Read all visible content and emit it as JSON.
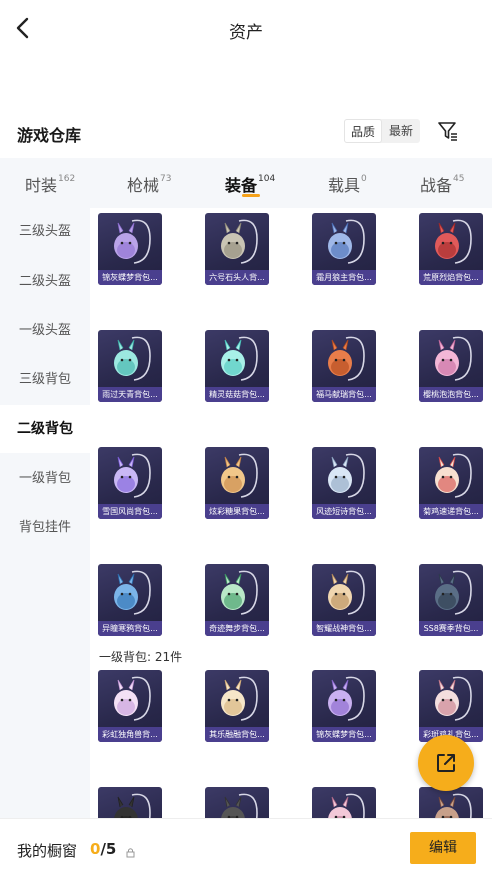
{
  "header": {
    "title": "资产"
  },
  "warehouse": {
    "title": "游戏仓库",
    "sort": [
      "品质",
      "最新"
    ]
  },
  "tabs": [
    {
      "label": "时装",
      "count": "162"
    },
    {
      "label": "枪械",
      "count": "73"
    },
    {
      "label": "装备",
      "count": "104"
    },
    {
      "label": "载具",
      "count": "0"
    },
    {
      "label": "战备",
      "count": "45"
    }
  ],
  "sidebar": [
    "三级头盔",
    "二级头盔",
    "一级头盔",
    "三级背包",
    "二级背包",
    "一级背包",
    "背包挂件"
  ],
  "grid": {
    "rows": [
      [
        "锦灰蝶梦背包...",
        "六号石头人背...",
        "霜月狼主背包...",
        "荒原烈焰背包..."
      ],
      [
        "雨过天青背包...",
        "精灵菇菇背包...",
        "福马献瑞背包...",
        "樱桃泡泡背包..."
      ],
      [
        "雪国风尚背包...",
        "炫彩糖果背包...",
        "风迹短诗背包...",
        "菊鸡速递背包..."
      ],
      [
        "异瞳寒鸦背包...",
        "奇迹舞步背包...",
        "智耀战神背包...",
        "SS8赛季背包..."
      ],
      [
        "彩虹独角兽背...",
        "其乐融融背包...",
        "锦灰蝶梦背包...",
        "彩斑鸡礼背包..."
      ],
      [
        "",
        "",
        "",
        ""
      ]
    ],
    "section_label": "一级背包: 21件"
  },
  "bottom": {
    "label": "我的橱窗",
    "current": "0",
    "total": "/5",
    "edit": "编辑"
  },
  "colors": {
    "accent": "#f6ad1b",
    "card_bg": "#2b2a4e",
    "card_label": "#4a3f8e"
  }
}
